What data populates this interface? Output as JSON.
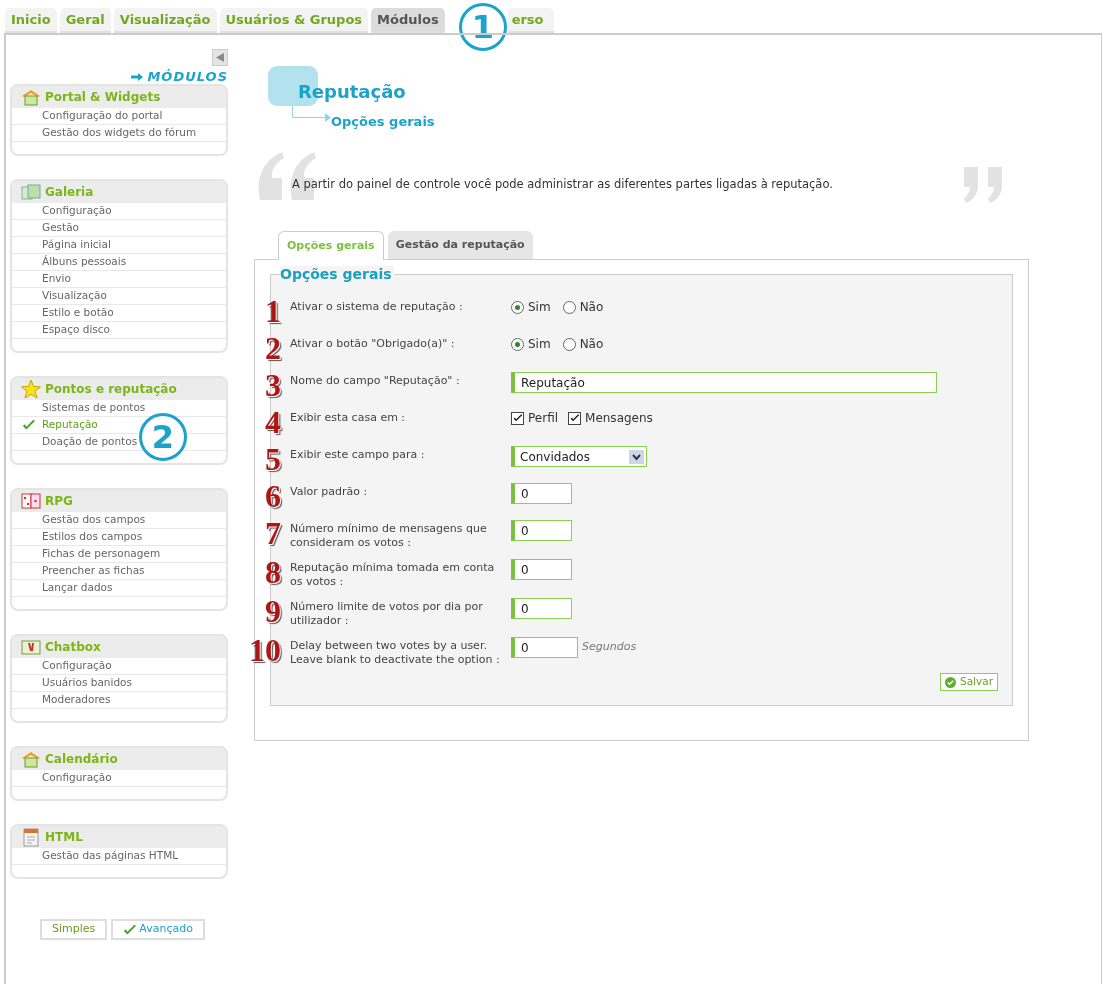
{
  "tabs": [
    {
      "label": "Inicio",
      "selected": false
    },
    {
      "label": "Geral",
      "selected": false
    },
    {
      "label": "Visualização",
      "selected": false
    },
    {
      "label": "Usuários & Grupos",
      "selected": false
    },
    {
      "label": "Módulos",
      "selected": true
    },
    {
      "label": "erso",
      "selected": false
    }
  ],
  "callouts": [
    "1",
    "2"
  ],
  "sidebar": {
    "heading": "MÓDULOS",
    "groups": [
      {
        "title": "Portal & Widgets",
        "items": [
          {
            "label": "Configuração do portal",
            "selected": false
          },
          {
            "label": "Gestão dos widgets do fórum",
            "selected": false
          }
        ]
      },
      {
        "title": "Galeria",
        "items": [
          {
            "label": "Configuração",
            "selected": false
          },
          {
            "label": "Gestão",
            "selected": false
          },
          {
            "label": "Página inicial",
            "selected": false
          },
          {
            "label": "Álbuns pessoais",
            "selected": false
          },
          {
            "label": "Envio",
            "selected": false
          },
          {
            "label": "Visualização",
            "selected": false
          },
          {
            "label": "Estilo e botão",
            "selected": false
          },
          {
            "label": "Espaço disco",
            "selected": false
          }
        ]
      },
      {
        "title": "Pontos e reputação",
        "items": [
          {
            "label": "Sistemas de pontos",
            "selected": false
          },
          {
            "label": "Reputação",
            "selected": true
          },
          {
            "label": "Doação de pontos",
            "selected": false
          }
        ]
      },
      {
        "title": "RPG",
        "items": [
          {
            "label": "Gestão dos campos",
            "selected": false
          },
          {
            "label": "Estilos dos campos",
            "selected": false
          },
          {
            "label": "Fichas de personagem",
            "selected": false
          },
          {
            "label": "Preencher as fichas",
            "selected": false
          },
          {
            "label": "Lançar dados",
            "selected": false
          }
        ]
      },
      {
        "title": "Chatbox",
        "items": [
          {
            "label": "Configuração",
            "selected": false
          },
          {
            "label": "Usuários banidos",
            "selected": false
          },
          {
            "label": "Moderadores",
            "selected": false
          }
        ]
      },
      {
        "title": "Calendário",
        "items": [
          {
            "label": "Configuração",
            "selected": false
          }
        ]
      },
      {
        "title": "HTML",
        "items": [
          {
            "label": "Gestão das páginas HTML",
            "selected": false
          }
        ]
      }
    ],
    "view_buttons": [
      {
        "label": "Simples",
        "selected": false
      },
      {
        "label": "Avançado",
        "selected": true
      }
    ]
  },
  "page": {
    "title": "Reputação",
    "subtitle": "Opções gerais",
    "intro": "A partir do painel de controle você pode administrar as diferentes partes ligadas à reputação."
  },
  "form_tabs": [
    {
      "label": "Opções gerais",
      "selected": true
    },
    {
      "label": "Gestão da reputação",
      "selected": false
    }
  ],
  "form": {
    "legend": "Opções gerais",
    "rows": [
      {
        "marker": "1",
        "label": "Ativar o sistema de reputação :",
        "kind": "radio",
        "options": [
          {
            "label": "Sim",
            "selected": true
          },
          {
            "label": "Não",
            "selected": false
          }
        ]
      },
      {
        "marker": "2",
        "label": "Ativar o botão \"Obrigado(a)\" :",
        "kind": "radio",
        "options": [
          {
            "label": "Sim",
            "selected": true
          },
          {
            "label": "Não",
            "selected": false
          }
        ]
      },
      {
        "marker": "3",
        "label": "Nome do campo \"Reputação\" :",
        "kind": "text",
        "value": "Reputação"
      },
      {
        "marker": "4",
        "label": "Exibir esta casa em :",
        "kind": "checkbox",
        "options": [
          {
            "label": "Perfil",
            "checked": true
          },
          {
            "label": "Mensagens",
            "checked": true
          }
        ]
      },
      {
        "marker": "5",
        "label": "Exibir este campo para :",
        "kind": "select",
        "value": "Convidados"
      },
      {
        "marker": "6",
        "label": "Valor padrão :",
        "kind": "number",
        "value": "0"
      },
      {
        "marker": "7",
        "label": "Número mínimo de mensagens que consideram os votos :",
        "kind": "number",
        "value": "0"
      },
      {
        "marker": "8",
        "label": "Reputação mínima tomada em conta os votos :",
        "kind": "number",
        "value": "0"
      },
      {
        "marker": "9",
        "label": "Número limite de votos por dia por utilizador :",
        "kind": "number",
        "value": "0"
      },
      {
        "marker": "10",
        "label": "Delay between two votes by a user. Leave blank to deactivate the option :",
        "kind": "number",
        "value": "0",
        "suffix": "Segundos"
      }
    ],
    "save": "Salvar"
  }
}
